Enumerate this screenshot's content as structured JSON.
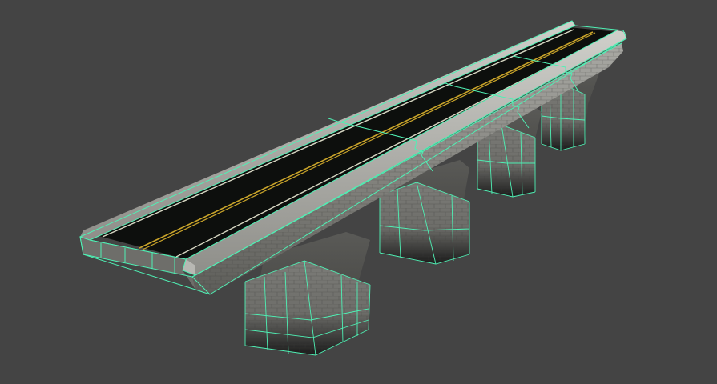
{
  "viewport": {
    "background_color": "#444444",
    "object": "bridge-model",
    "display_mode": "smooth-shade-with-wireframe",
    "wireframe_color": "#4ff0b4",
    "road_color": "#0d0f0d",
    "lane_line_color": "#c9a42a",
    "edge_line_color": "#d8d8c4",
    "stone_color": "#8a8a86"
  }
}
